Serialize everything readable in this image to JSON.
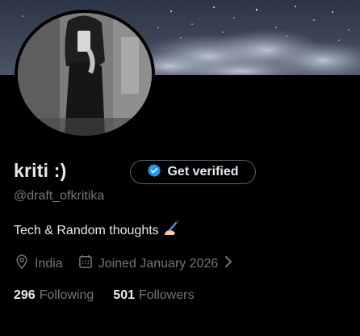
{
  "profile": {
    "name": "kriti :)",
    "handle": "@draft_ofkritika",
    "bio": "Tech & Random thoughts",
    "bio_emoji": "writing-hand-emoji",
    "location": "India",
    "joined": "Joined January 2026",
    "verify_label": "Get verified"
  },
  "stats": {
    "following_count": "296",
    "following_label": "Following",
    "followers_count": "501",
    "followers_label": "Followers"
  },
  "icons": {
    "verified": "verified-badge-icon",
    "location": "location-pin-icon",
    "calendar": "calendar-icon",
    "chevron": "chevron-right-icon"
  },
  "colors": {
    "background": "#000000",
    "primary_text": "#e7e9ea",
    "secondary_text": "#71767b",
    "verified_blue": "#1d9bf0",
    "button_border": "#536471"
  }
}
